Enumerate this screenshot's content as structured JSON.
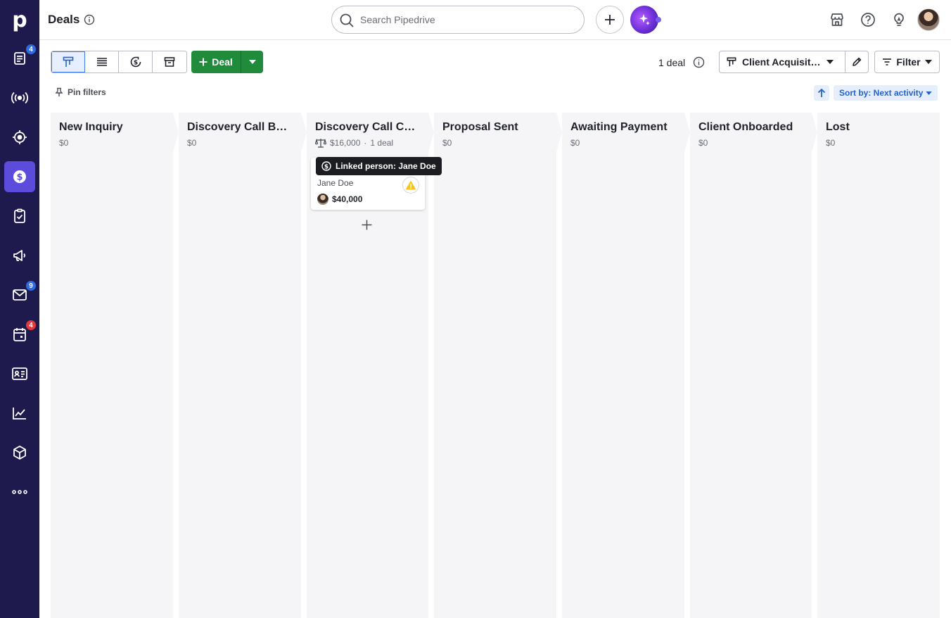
{
  "sidebar": {
    "logo": "p",
    "items": [
      {
        "name": "leads-icon",
        "badge": "4",
        "badge_color": "blue"
      },
      {
        "name": "broadcast-icon",
        "badge": ""
      },
      {
        "name": "target-icon",
        "badge": ""
      },
      {
        "name": "deals-icon",
        "badge": "",
        "active": true
      },
      {
        "name": "tasks-icon",
        "badge": ""
      },
      {
        "name": "campaigns-icon",
        "badge": ""
      },
      {
        "name": "mail-icon",
        "badge": "9",
        "badge_color": "blue"
      },
      {
        "name": "calendar-icon",
        "badge": "4",
        "badge_color": "red"
      },
      {
        "name": "contacts-icon",
        "badge": ""
      },
      {
        "name": "insights-icon",
        "badge": ""
      },
      {
        "name": "products-icon",
        "badge": ""
      },
      {
        "name": "more-icon",
        "badge": ""
      }
    ]
  },
  "header": {
    "title": "Deals",
    "search_placeholder": "Search Pipedrive"
  },
  "toolbar": {
    "deal_label": "Deal",
    "deal_count": "1 deal",
    "pipeline": "Client Acquisition Pipeline",
    "filter_label": "Filter",
    "pin_filters": "Pin filters",
    "sort_label": "Sort by: Next activity"
  },
  "stages": [
    {
      "title": "New Inquiry",
      "amount": "$0",
      "count": ""
    },
    {
      "title": "Discovery Call Booked",
      "amount": "$0",
      "count": ""
    },
    {
      "title": "Discovery Call Completed",
      "amount": "$16,000",
      "count": "1 deal"
    },
    {
      "title": "Proposal Sent",
      "amount": "$0",
      "count": ""
    },
    {
      "title": "Awaiting Payment",
      "amount": "$0",
      "count": ""
    },
    {
      "title": "Client Onboarded",
      "amount": "$0",
      "count": ""
    },
    {
      "title": "Lost",
      "amount": "$0",
      "count": ""
    }
  ],
  "card": {
    "person": "Jane Doe",
    "value": "$40,000"
  },
  "tooltip": {
    "text": "Linked person: Jane Doe"
  },
  "colors": {
    "sidebar_bg": "#1f1a4d",
    "active_nav": "#5b4cdc",
    "deal_button": "#1f8b3b",
    "accent_blue": "#2463c9"
  }
}
